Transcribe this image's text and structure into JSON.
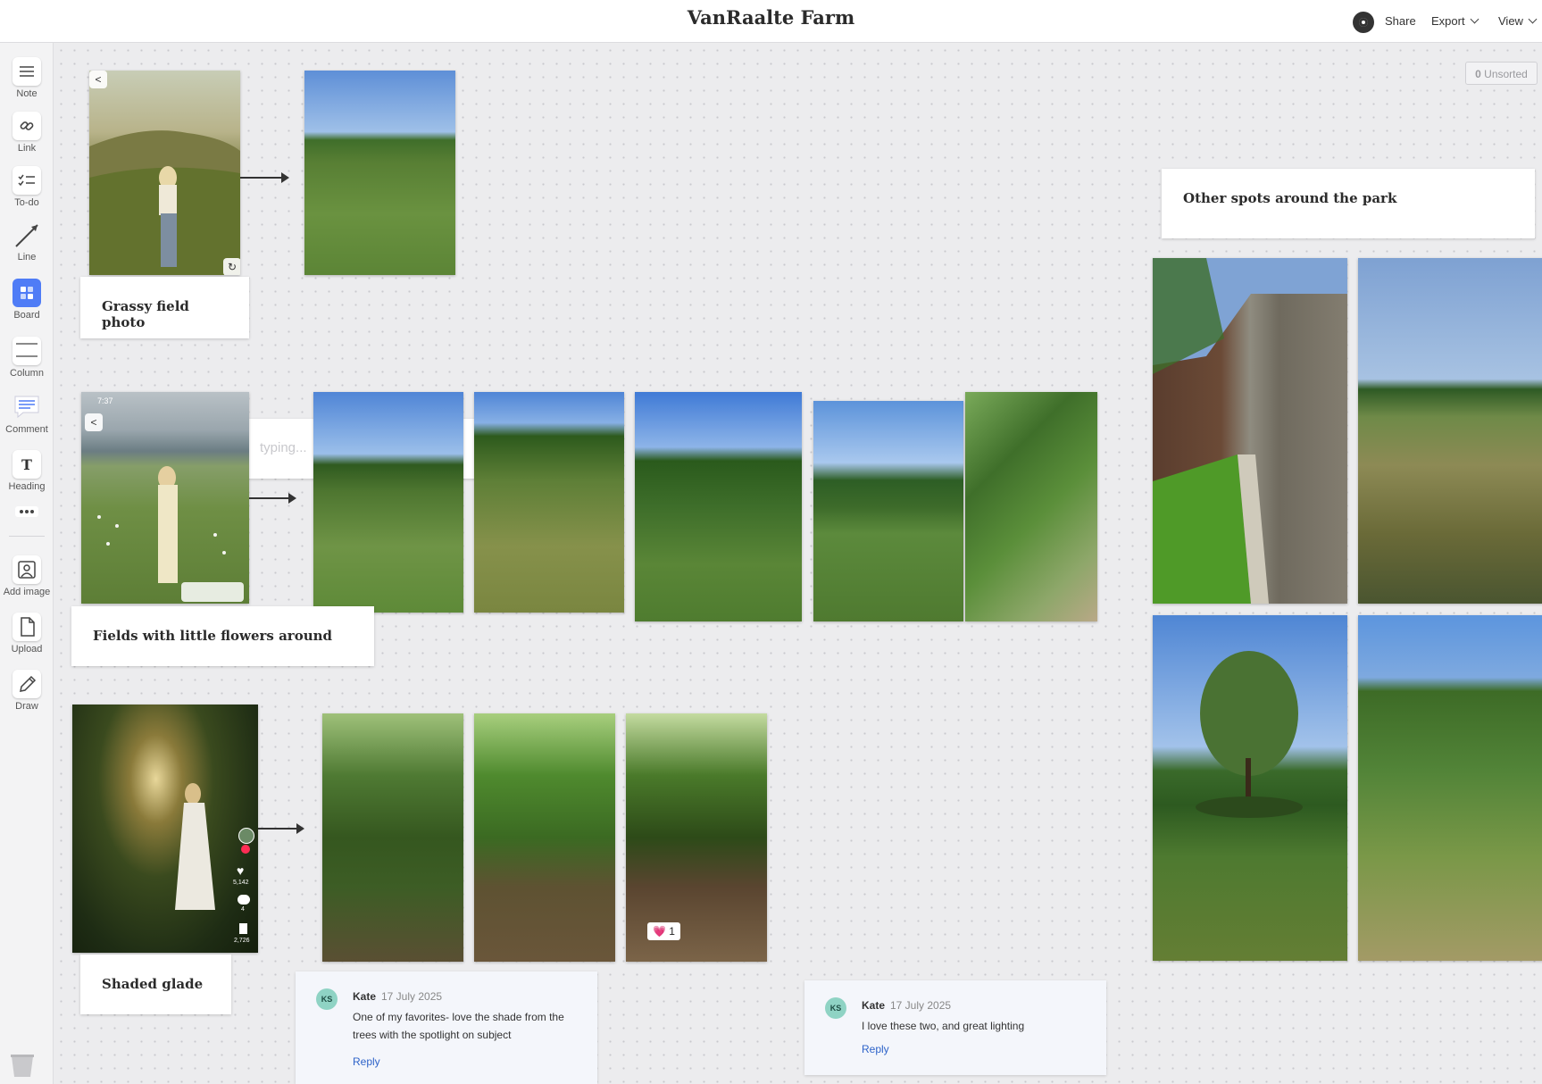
{
  "app": {
    "title": "VanRaalte Farm",
    "share_label": "Share",
    "export_label": "Export",
    "view_label": "View"
  },
  "sidebar": {
    "tools": [
      {
        "label": "Note",
        "icon": "note-icon"
      },
      {
        "label": "Link",
        "icon": "link-icon"
      },
      {
        "label": "To-do",
        "icon": "todo-icon"
      },
      {
        "label": "Line",
        "icon": "line-icon"
      },
      {
        "label": "Board",
        "icon": "board-icon"
      },
      {
        "label": "Column",
        "icon": "column-icon"
      },
      {
        "label": "Comment",
        "icon": "comment-icon"
      },
      {
        "label": "Heading",
        "icon": "heading-icon"
      },
      {
        "label": "",
        "icon": "more-icon"
      },
      {
        "label": "Add image",
        "icon": "add-image-icon"
      },
      {
        "label": "Upload",
        "icon": "upload-icon"
      },
      {
        "label": "Draw",
        "icon": "draw-icon"
      }
    ],
    "trash_icon": "trash-icon",
    "board_accent": "#4f7cf6"
  },
  "canvas": {
    "unsorted": {
      "count": "0",
      "label": "Unsorted"
    },
    "cards": {
      "grassy": "Grassy field photo",
      "fields": "Fields with little flowers around",
      "shaded": "Shaded glade",
      "other": "Other spots around the park"
    },
    "typing_placeholder": "typing...",
    "reaction": {
      "emoji": "💗",
      "count": "1"
    },
    "phone_overlays": {
      "time": "7:37",
      "likes": "5,142",
      "comments": "4",
      "saves": "2,726"
    },
    "comments": [
      {
        "initials": "KS",
        "author": "Kate",
        "date": "17 July 2025",
        "text": "One of my favorites- love the shade from the trees with the spotlight on subject",
        "reply": "Reply"
      },
      {
        "initials": "KS",
        "author": "Kate",
        "date": "17 July 2025",
        "text": "I love these two, and great lighting",
        "reply": "Reply"
      }
    ]
  }
}
